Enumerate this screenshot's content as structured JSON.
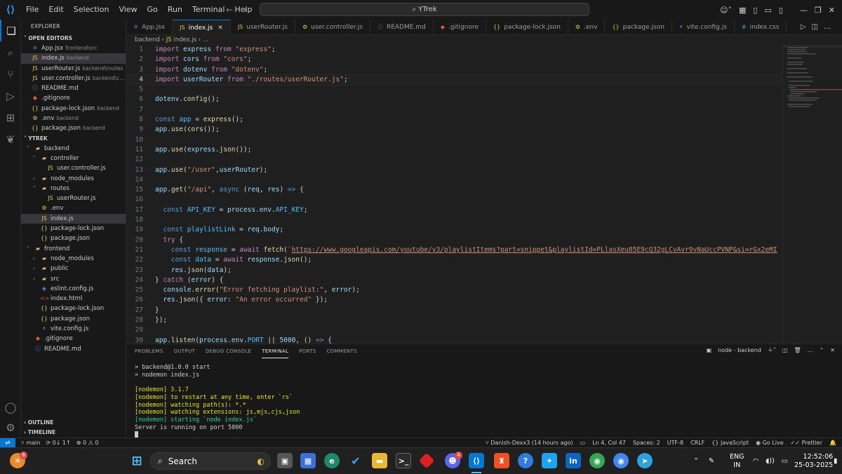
{
  "window": {
    "search": "YTrek"
  },
  "menu": [
    "File",
    "Edit",
    "Selection",
    "View",
    "Go",
    "Run",
    "Terminal",
    "Help"
  ],
  "explorer": {
    "title": "EXPLORER",
    "open_editors_label": "OPEN EDITORS",
    "open_editors": [
      {
        "name": "App.jsx",
        "path": "frontend\\src",
        "icon": "react-icon"
      },
      {
        "name": "index.js",
        "path": "backend",
        "icon": "js-icon",
        "selected": true
      },
      {
        "name": "userRouter.js",
        "path": "backend\\routes",
        "icon": "js-icon"
      },
      {
        "name": "user.controller.js",
        "path": "backend\\c...",
        "icon": "js-icon"
      },
      {
        "name": "README.md",
        "path": "",
        "icon": "info-icon"
      },
      {
        "name": ".gitignore",
        "path": "",
        "icon": "git-icon"
      },
      {
        "name": "package-lock.json",
        "path": "backend",
        "icon": "json-icon"
      },
      {
        "name": ".env",
        "path": "backend",
        "icon": "env-icon"
      },
      {
        "name": "package.json",
        "path": "backend",
        "icon": "json-icon"
      }
    ],
    "project_label": "YTREK",
    "tree": [
      {
        "name": "backend",
        "depth": 0,
        "type": "folder",
        "chev": "open"
      },
      {
        "name": "controller",
        "depth": 1,
        "type": "folder",
        "chev": "open"
      },
      {
        "name": "user.controller.js",
        "depth": 2,
        "type": "js"
      },
      {
        "name": "node_modules",
        "depth": 1,
        "type": "folder",
        "chev": "closed"
      },
      {
        "name": "routes",
        "depth": 1,
        "type": "folder",
        "chev": "open"
      },
      {
        "name": "userRouter.js",
        "depth": 2,
        "type": "js"
      },
      {
        "name": ".env",
        "depth": 1,
        "type": "env"
      },
      {
        "name": "index.js",
        "depth": 1,
        "type": "js",
        "selected": true
      },
      {
        "name": "package-lock.json",
        "depth": 1,
        "type": "json"
      },
      {
        "name": "package.json",
        "depth": 1,
        "type": "json"
      },
      {
        "name": "frontend",
        "depth": 0,
        "type": "folder",
        "chev": "open"
      },
      {
        "name": "node_modules",
        "depth": 1,
        "type": "folder",
        "chev": "closed"
      },
      {
        "name": "public",
        "depth": 1,
        "type": "folder",
        "chev": "closed"
      },
      {
        "name": "src",
        "depth": 1,
        "type": "folder",
        "chev": "closed"
      },
      {
        "name": "eslint.config.js",
        "depth": 1,
        "type": "eslint"
      },
      {
        "name": "index.html",
        "depth": 1,
        "type": "html"
      },
      {
        "name": "package-lock.json",
        "depth": 1,
        "type": "json"
      },
      {
        "name": "package.json",
        "depth": 1,
        "type": "json"
      },
      {
        "name": "vite.config.js",
        "depth": 1,
        "type": "vite"
      },
      {
        "name": ".gitignore",
        "depth": 0,
        "type": "git"
      },
      {
        "name": "README.md",
        "depth": 0,
        "type": "md"
      }
    ],
    "outline_label": "OUTLINE",
    "timeline_label": "TIMELINE"
  },
  "tabs": [
    {
      "name": "App.jsx",
      "icon": "react-icon"
    },
    {
      "name": "index.js",
      "icon": "js-icon",
      "active": true
    },
    {
      "name": "userRouter.js",
      "icon": "js-icon"
    },
    {
      "name": "user.controller.js",
      "icon": "gear-icon"
    },
    {
      "name": "README.md",
      "icon": "info-icon"
    },
    {
      "name": ".gitignore",
      "icon": "git-icon"
    },
    {
      "name": "package-lock.json",
      "icon": "json-icon"
    },
    {
      "name": ".env",
      "icon": "env-icon"
    },
    {
      "name": "package.json",
      "icon": "json-icon"
    },
    {
      "name": "vite.config.js",
      "icon": "vite-icon"
    },
    {
      "name": "index.css",
      "icon": "css-icon"
    }
  ],
  "breadcrumb": {
    "folder": "backend",
    "file": "index.js",
    "tail": "..."
  },
  "code": [
    {
      "n": 1,
      "t": [
        [
          "kw",
          "import "
        ],
        [
          "var",
          "express "
        ],
        [
          "kw",
          "from "
        ],
        [
          "str",
          "\"express\""
        ],
        [
          "",
          "; "
        ]
      ]
    },
    {
      "n": 2,
      "t": [
        [
          "kw",
          "import "
        ],
        [
          "var",
          "cors "
        ],
        [
          "kw",
          "from "
        ],
        [
          "str",
          "\"cors\""
        ],
        [
          "",
          ";"
        ]
      ]
    },
    {
      "n": 3,
      "t": [
        [
          "kw",
          "import "
        ],
        [
          "var",
          "dotenv "
        ],
        [
          "kw",
          "from "
        ],
        [
          "str",
          "\"dotenv\""
        ],
        [
          "",
          ";"
        ]
      ]
    },
    {
      "n": 4,
      "t": [
        [
          "kw",
          "import "
        ],
        [
          "var",
          "userRouter "
        ],
        [
          "kw",
          "from "
        ],
        [
          "str",
          "\"./routes/userRouter.js\""
        ],
        [
          "",
          ";"
        ]
      ],
      "cur": true
    },
    {
      "n": 5,
      "t": []
    },
    {
      "n": 6,
      "t": [
        [
          "var",
          "dotenv"
        ],
        [
          "",
          "."
        ],
        [
          "fn",
          "config"
        ],
        [
          "",
          "();"
        ]
      ]
    },
    {
      "n": 7,
      "t": []
    },
    {
      "n": 8,
      "t": [
        [
          "dec",
          "const "
        ],
        [
          "const",
          "app "
        ],
        [
          "",
          "= "
        ],
        [
          "fn",
          "express"
        ],
        [
          "",
          "();"
        ]
      ]
    },
    {
      "n": 9,
      "t": [
        [
          "var",
          "app"
        ],
        [
          "",
          "."
        ],
        [
          "fn",
          "use"
        ],
        [
          "",
          "("
        ],
        [
          "fn",
          "cors"
        ],
        [
          "",
          "());"
        ]
      ]
    },
    {
      "n": 10,
      "t": []
    },
    {
      "n": 11,
      "t": [
        [
          "var",
          "app"
        ],
        [
          "",
          "."
        ],
        [
          "fn",
          "use"
        ],
        [
          "",
          "("
        ],
        [
          "var",
          "express"
        ],
        [
          "",
          "."
        ],
        [
          "fn",
          "json"
        ],
        [
          "",
          "());"
        ]
      ]
    },
    {
      "n": 12,
      "t": []
    },
    {
      "n": 13,
      "t": [
        [
          "var",
          "app"
        ],
        [
          "",
          "."
        ],
        [
          "fn",
          "use"
        ],
        [
          "",
          "("
        ],
        [
          "str",
          "\"/user\""
        ],
        [
          "",
          ","
        ],
        [
          "var",
          "userRouter"
        ],
        [
          "",
          ");"
        ]
      ]
    },
    {
      "n": 14,
      "t": []
    },
    {
      "n": 15,
      "t": [
        [
          "var",
          "app"
        ],
        [
          "",
          "."
        ],
        [
          "fn",
          "get"
        ],
        [
          "",
          "("
        ],
        [
          "str",
          "\"/api\""
        ],
        [
          "",
          ", "
        ],
        [
          "dec",
          "async "
        ],
        [
          "",
          "("
        ],
        [
          "var",
          "req"
        ],
        [
          "",
          ", "
        ],
        [
          "var",
          "res"
        ],
        [
          "",
          ") "
        ],
        [
          "dec",
          "=> "
        ],
        [
          "",
          "{"
        ]
      ]
    },
    {
      "n": 16,
      "t": []
    },
    {
      "n": 17,
      "t": [
        [
          "",
          "  "
        ],
        [
          "dec",
          "const "
        ],
        [
          "const",
          "API_KEY "
        ],
        [
          "",
          "= "
        ],
        [
          "var",
          "process"
        ],
        [
          "",
          "."
        ],
        [
          "var",
          "env"
        ],
        [
          "",
          "."
        ],
        [
          "const",
          "API_KEY"
        ],
        [
          "",
          ";"
        ]
      ]
    },
    {
      "n": 18,
      "t": []
    },
    {
      "n": 19,
      "t": [
        [
          "",
          "  "
        ],
        [
          "dec",
          "const "
        ],
        [
          "const",
          "playlistLink "
        ],
        [
          "",
          "= "
        ],
        [
          "var",
          "req"
        ],
        [
          "",
          "."
        ],
        [
          "var",
          "body"
        ],
        [
          "",
          ";"
        ]
      ]
    },
    {
      "n": 20,
      "t": [
        [
          "",
          "  "
        ],
        [
          "kw",
          "try "
        ],
        [
          "",
          "{"
        ]
      ]
    },
    {
      "n": 21,
      "t": [
        [
          "",
          "    "
        ],
        [
          "dec",
          "const "
        ],
        [
          "const",
          "response "
        ],
        [
          "",
          "= "
        ],
        [
          "kw",
          "await "
        ],
        [
          "fn",
          "fetch"
        ],
        [
          "",
          "("
        ],
        [
          "str",
          "`"
        ],
        [
          "url",
          "https://www.googleapis.com/youtube/v3/playlistItems?part=snippet&playlistId=PLlasXeu85E9cQ32gLCvAvr9vNaUccPVNP&si=rGx2eMI"
        ]
      ]
    },
    {
      "n": 22,
      "t": [
        [
          "",
          "    "
        ],
        [
          "dec",
          "const "
        ],
        [
          "const",
          "data "
        ],
        [
          "",
          "= "
        ],
        [
          "kw",
          "await "
        ],
        [
          "var",
          "response"
        ],
        [
          "",
          "."
        ],
        [
          "fn",
          "json"
        ],
        [
          "",
          "();"
        ]
      ]
    },
    {
      "n": 23,
      "t": [
        [
          "",
          "    "
        ],
        [
          "var",
          "res"
        ],
        [
          "",
          "."
        ],
        [
          "fn",
          "json"
        ],
        [
          "",
          "("
        ],
        [
          "var",
          "data"
        ],
        [
          "",
          ");"
        ]
      ]
    },
    {
      "n": 24,
      "t": [
        [
          "",
          "} "
        ],
        [
          "kw",
          "catch "
        ],
        [
          "",
          "("
        ],
        [
          "var",
          "error"
        ],
        [
          "",
          ") {"
        ]
      ]
    },
    {
      "n": 25,
      "t": [
        [
          "",
          "  "
        ],
        [
          "var",
          "console"
        ],
        [
          "",
          "."
        ],
        [
          "fn",
          "error"
        ],
        [
          "",
          "("
        ],
        [
          "str",
          "\"Error fetching playlist:\""
        ],
        [
          "",
          ", "
        ],
        [
          "var",
          "error"
        ],
        [
          "",
          ");"
        ]
      ]
    },
    {
      "n": 26,
      "t": [
        [
          "",
          "  "
        ],
        [
          "var",
          "res"
        ],
        [
          "",
          "."
        ],
        [
          "fn",
          "json"
        ],
        [
          "",
          "({ "
        ],
        [
          "var",
          "error"
        ],
        [
          "",
          ": "
        ],
        [
          "str",
          "\"An error occurred\""
        ],
        [
          "",
          " });"
        ]
      ]
    },
    {
      "n": 27,
      "t": [
        [
          "",
          "}"
        ]
      ]
    },
    {
      "n": 28,
      "t": [
        [
          "",
          "});"
        ]
      ]
    },
    {
      "n": 29,
      "t": []
    },
    {
      "n": 30,
      "t": [
        [
          "var",
          "app"
        ],
        [
          "",
          "."
        ],
        [
          "fn",
          "listen"
        ],
        [
          "",
          "("
        ],
        [
          "var",
          "process"
        ],
        [
          "",
          "."
        ],
        [
          "var",
          "env"
        ],
        [
          "",
          "."
        ],
        [
          "const",
          "PORT "
        ],
        [
          "",
          "|| "
        ],
        [
          "var",
          "5000"
        ],
        [
          "",
          ", () "
        ],
        [
          "dec",
          "=> "
        ],
        [
          "",
          "{"
        ]
      ]
    }
  ],
  "panel": {
    "tabs": [
      "PROBLEMS",
      "OUTPUT",
      "DEBUG CONSOLE",
      "TERMINAL",
      "PORTS",
      "COMMENTS"
    ],
    "active": "TERMINAL",
    "terminal_name": "node - backend",
    "lines": [
      {
        "c": "",
        "t": "> backend@1.0.0 start"
      },
      {
        "c": "",
        "t": "> nodemon index.js"
      },
      {
        "c": "",
        "t": " "
      },
      {
        "c": "y",
        "t": "[nodemon] 3.1.7"
      },
      {
        "c": "y",
        "t": "[nodemon] to restart at any time, enter `rs`"
      },
      {
        "c": "y",
        "t": "[nodemon] watching path(s): *.*"
      },
      {
        "c": "y",
        "t": "[nodemon] watching extensions: js,mjs,cjs,json"
      },
      {
        "c": "g",
        "t": "[nodemon] starting `node index.js`"
      },
      {
        "c": "",
        "t": "Server is running on port 5000"
      }
    ]
  },
  "status": {
    "branch": "main",
    "sync": "0↓ 1↑",
    "errors": "0",
    "warnings": "0",
    "blame": "Danish-Dexx3 (14 hours ago)",
    "position": "Ln 4, Col 47",
    "spaces": "Spaces: 2",
    "encoding": "UTF-8",
    "eol": "CRLF",
    "language": "JavaScript",
    "golive": "Go Live",
    "prettier": "Prettier"
  },
  "taskbar": {
    "search": "Search",
    "lang": "ENG",
    "region": "IN",
    "time": "12:52:06",
    "date": "25-03-2025",
    "weather_badge": "8",
    "discord_badge": "4"
  }
}
